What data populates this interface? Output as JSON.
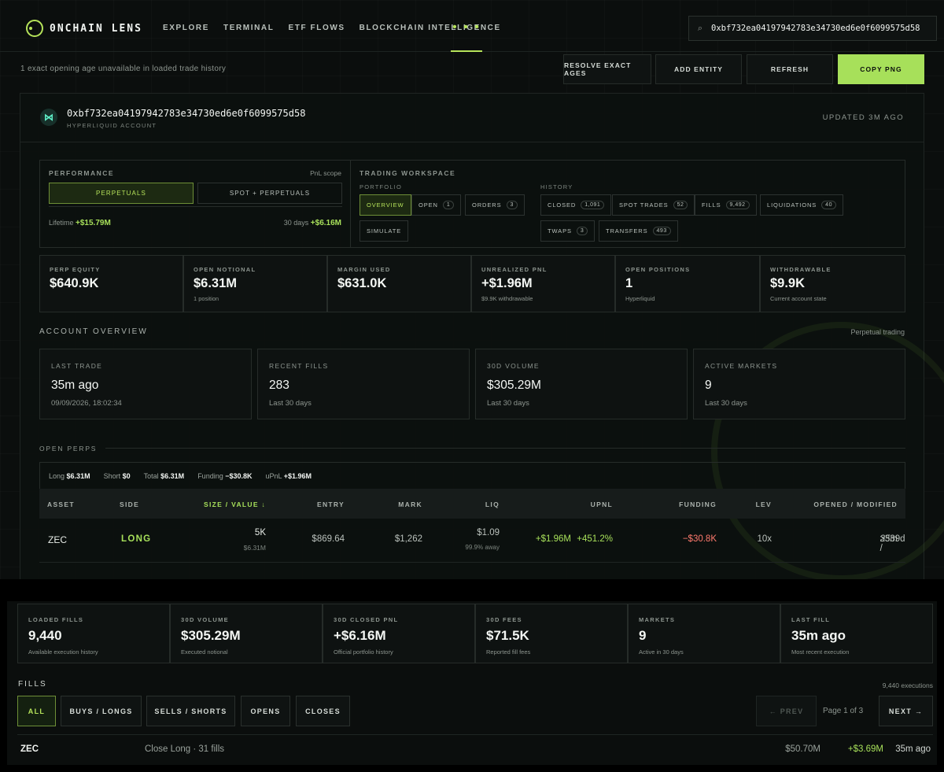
{
  "nav": {
    "logo": "0NCHAIN LENS",
    "links": [
      "EXPLORE",
      "TERMINAL",
      "ETF FLOWS",
      "BLOCKCHAIN INTELLIGENCE"
    ],
    "more": "• • •",
    "search_value": "0xbf732ea04197942783e34730ed6e0f6099575d58"
  },
  "action_bar": {
    "status": "1 exact opening age unavailable in loaded trade history",
    "resolve": "RESOLVE EXACT AGES",
    "add_entity": "ADD ENTITY",
    "refresh": "REFRESH",
    "copy_png": "COPY PNG"
  },
  "account": {
    "address": "0xbf732ea04197942783e34730ed6e0f6099575d58",
    "type": "HYPERLIQUID ACCOUNT",
    "updated": "UPDATED 3M AGO"
  },
  "performance": {
    "title": "PERFORMANCE",
    "scope": "PnL scope",
    "perpetuals": "PERPETUALS",
    "spot_perp": "SPOT + PERPETUALS",
    "lifetime_label": "Lifetime",
    "lifetime_value": "+$15.79M",
    "days30_label": "30 days",
    "days30_value": "+$6.16M"
  },
  "workspace": {
    "title": "TRADING WORKSPACE",
    "portfolio_label": "PORTFOLIO",
    "history_label": "HISTORY",
    "overview": "OVERVIEW",
    "open": "OPEN",
    "open_count": "1",
    "orders": "ORDERS",
    "orders_count": "3",
    "simulate": "SIMULATE",
    "closed": "CLOSED",
    "closed_count": "1,091",
    "spot_trades": "SPOT TRADES",
    "spot_trades_count": "52",
    "fills": "FILLS",
    "fills_count": "9,492",
    "liquidations": "LIQUIDATIONS",
    "liquidations_count": "40",
    "twaps": "TWAPS",
    "twaps_count": "3",
    "transfers": "TRANSFERS",
    "transfers_count": "493"
  },
  "metrics": [
    {
      "label": "PERP EQUITY",
      "value": "$640.9K",
      "sub": ""
    },
    {
      "label": "OPEN NOTIONAL",
      "value": "$6.31M",
      "sub": "1 position"
    },
    {
      "label": "MARGIN USED",
      "value": "$631.0K",
      "sub": ""
    },
    {
      "label": "UNREALIZED PNL",
      "value": "+$1.96M",
      "sub": "$9.9K withdrawable"
    },
    {
      "label": "OPEN POSITIONS",
      "value": "1",
      "sub": "Hyperliquid"
    },
    {
      "label": "WITHDRAWABLE",
      "value": "$9.9K",
      "sub": "Current account state"
    }
  ],
  "overview": {
    "title": "ACCOUNT OVERVIEW",
    "scope": "Perpetual trading",
    "cards": [
      {
        "label": "LAST TRADE",
        "value": "35m ago",
        "sub": "09/09/2026, 18:02:34"
      },
      {
        "label": "RECENT FILLS",
        "value": "283",
        "sub": "Last 30 days"
      },
      {
        "label": "30D VOLUME",
        "value": "$305.29M",
        "sub": "Last 30 days"
      },
      {
        "label": "ACTIVE MARKETS",
        "value": "9",
        "sub": "Last 30 days"
      }
    ]
  },
  "perps": {
    "title": "OPEN PERPS",
    "long_label": "Long",
    "long_value": "$6.31M",
    "short_label": "Short",
    "short_value": "$0",
    "total_label": "Total",
    "total_value": "$6.31M",
    "funding_label": "Funding",
    "funding_value": "−$30.8K",
    "upnl_label": "uPnL",
    "upnl_value": "+$1.96M",
    "columns": [
      "ASSET",
      "SIDE",
      "SIZE / VALUE ↓",
      "ENTRY",
      "MARK",
      "LIQ",
      "UPNL",
      "FUNDING",
      "LEV",
      "OPENED / MODIFIED"
    ],
    "row": {
      "asset": "ZEC",
      "side": "LONG",
      "size": "5K",
      "value": "$6.31M",
      "entry": "$869.64",
      "mark": "$1,262",
      "liq": "$1.09",
      "liq_away": "99.9% away",
      "upnl": "+$1.96M",
      "upnl_pct": "+451.2%",
      "funding": "−$30.8K",
      "lev": "10x",
      "opened": "≥339d /",
      "modified": "35m"
    }
  },
  "fill_stats": [
    {
      "label": "LOADED FILLS",
      "value": "9,440",
      "sub": "Available execution history"
    },
    {
      "label": "30D VOLUME",
      "value": "$305.29M",
      "sub": "Executed notional"
    },
    {
      "label": "30D CLOSED PNL",
      "value": "+$6.16M",
      "sub": "Official portfolio history"
    },
    {
      "label": "30D FEES",
      "value": "$71.5K",
      "sub": "Reported fill fees"
    },
    {
      "label": "MARKETS",
      "value": "9",
      "sub": "Active in 30 days"
    },
    {
      "label": "LAST FILL",
      "value": "35m ago",
      "sub": "Most recent execution"
    }
  ],
  "fills": {
    "title": "FILLS",
    "count": "9,440 executions",
    "filters": [
      "ALL",
      "BUYS / LONGS",
      "SELLS / SHORTS",
      "OPENS",
      "CLOSES"
    ],
    "prev": "← PREV",
    "page": "Page 1 of 3",
    "next": "NEXT →",
    "row": {
      "asset": "ZEC",
      "desc": "Close Long · 31 fills",
      "notional": "$50.70M",
      "pnl": "+$3.69M",
      "age": "35m ago"
    }
  }
}
